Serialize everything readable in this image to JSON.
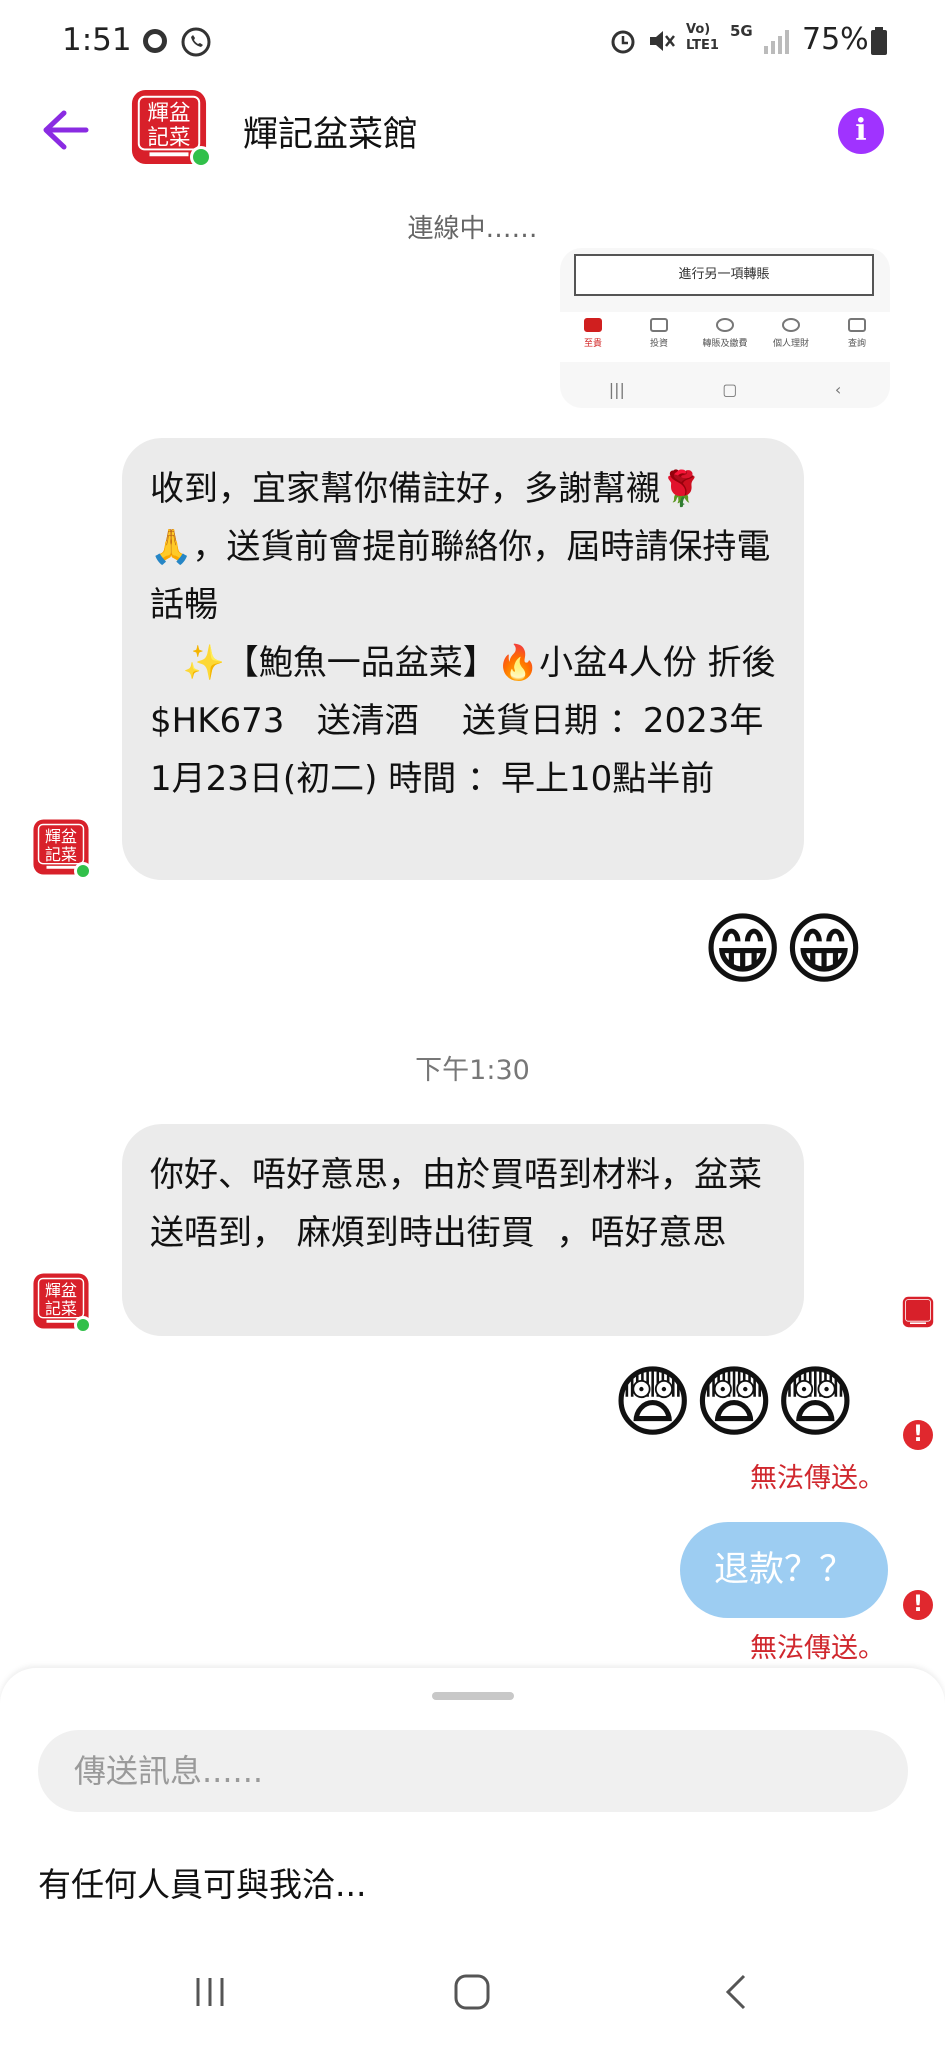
{
  "status_bar": {
    "time": "1:51",
    "battery": "75%",
    "network": "5G",
    "volte": "Vo) LTE1"
  },
  "header": {
    "title": "輝記盆菜館",
    "avatar_text": "輝盆記菜"
  },
  "attachment": {
    "button_label": "進行另一項轉賬",
    "nav_items": [
      "至貴",
      "投資",
      "轉賬及繳費",
      "個人理財",
      "查詢"
    ]
  },
  "connecting_label": "連線中……",
  "messages": [
    {
      "from": "shop",
      "text": "收到，宜家幫你備註好，多謝幫襯🌹🙏，送貨前會提前聯絡你，屆時請保持電話暢\n   ✨【鮑魚一品盆菜】🔥小盆4人份 折後$HK673   送清酒    送貨日期 ：2023年1月23日(初二) 時間 ：早上10點半前"
    },
    {
      "from": "me",
      "emoji": "😁😁"
    },
    {
      "timestamp": "下午1:30"
    },
    {
      "from": "shop",
      "text": "你好、唔好意思，由於買唔到材料，盆菜送唔到， 麻煩到時出街買  ，唔好意思"
    },
    {
      "from": "me",
      "emoji": "😨😨😨",
      "error": "無法傳送。"
    },
    {
      "from": "me",
      "text": "退款？？",
      "error": "無法傳送。"
    }
  ],
  "composer": {
    "placeholder": "傳送訊息......",
    "suggestion": "有任何人員可與我洽..."
  },
  "colors": {
    "accent": "#a033ff",
    "outgoing_bubble": "#9dcdf2",
    "incoming_bubble": "#ebebeb",
    "error": "#d0282e",
    "online": "#31c04a"
  }
}
